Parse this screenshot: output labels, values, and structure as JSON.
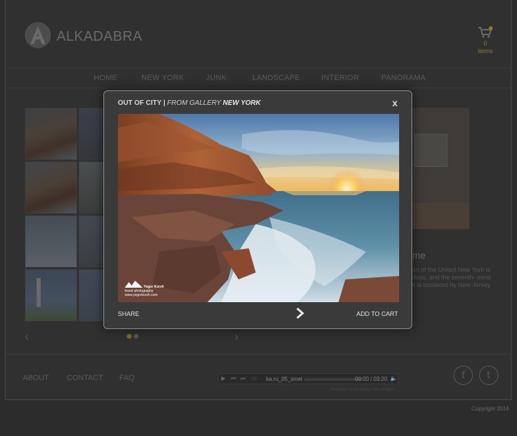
{
  "header": {
    "brand": "ALKADABRA",
    "logo_letter": "A",
    "cart_count": "0",
    "cart_label": "items",
    "cart_icon": "cart-icon"
  },
  "nav": {
    "items": [
      "HOME",
      "NEW YORK",
      "JUNK",
      "LANDSCAPE",
      "INTERIOR",
      "PANORAMA"
    ]
  },
  "aside": {
    "heading": "me",
    "text": "on of the United New York is dous, and the seventh- most k is bordered by New Jersey"
  },
  "modal": {
    "title": "OUT OF CITY",
    "separator": "|",
    "subtitle": "FROM GALLERY",
    "gallery": "NEW YORK",
    "close_label": "x",
    "share_label": "SHARE",
    "next_icon": "chevron-right-icon",
    "add_to_cart_label": "ADD TO CART",
    "watermark_name": "Yegor Korzh",
    "watermark_sub": "travel photography",
    "watermark_url": "www.yegorkorzh.com"
  },
  "footer": {
    "links": [
      "ABOUT",
      "CONTACT",
      "FAQ"
    ],
    "player": {
      "track": "ka.ru_05_smel",
      "time": "00:00 / 03:20",
      "powered": "Powered by Amazing Audio Player"
    },
    "social": [
      "facebook-icon",
      "twitter-icon"
    ],
    "copyright": "Copyright 2014"
  },
  "colors": {
    "background": "#2c2c2c",
    "accent": "#8a7a2a",
    "modal_bg": "#3a3a3a"
  }
}
